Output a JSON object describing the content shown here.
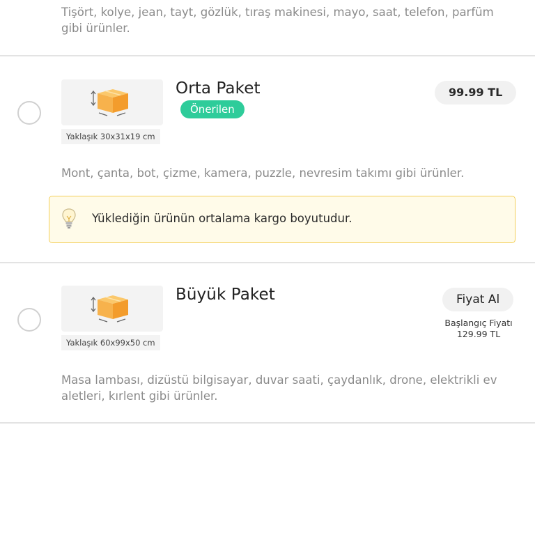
{
  "previous": {
    "description": "Tişört, kolye, jean, tayt, gözlük, tıraş makinesi, mayo, saat, telefon, parfüm gibi ürünler."
  },
  "packages": [
    {
      "title": "Orta Paket",
      "badge": "Önerilen",
      "price": "99.99 TL",
      "size": "Yaklaşık 30x31x19 cm",
      "description": "Mont, çanta, bot, çizme, kamera, puzzle, nevresim takımı gibi ürünler.",
      "tip": "Yüklediğin ürünün ortalama kargo boyutudur.",
      "selected": false
    },
    {
      "title": "Büyük Paket",
      "price_button": "Fiyat Al",
      "start_price_label": "Başlangıç Fiyatı",
      "start_price": "129.99 TL",
      "size": "Yaklaşık 60x99x50 cm",
      "description": "Masa lambası, dizüstü bilgisayar, duvar saati, çaydanlık, drone, elektrikli ev aletleri, kırlent gibi ürünler.",
      "selected": false
    }
  ],
  "colors": {
    "badge": "#2ecc9a",
    "tip_border": "#f3cf59",
    "tip_bg": "#fffbe9",
    "box": "#f7b24c"
  },
  "icons": [
    "box-icon",
    "lightbulb-icon",
    "radio-button"
  ]
}
